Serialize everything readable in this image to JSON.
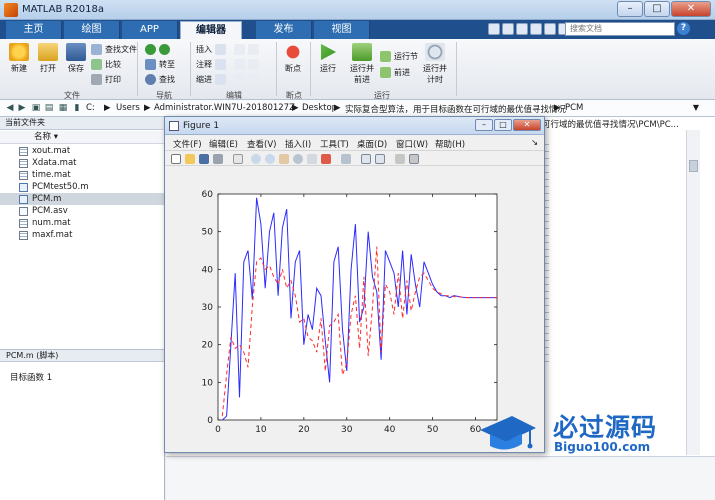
{
  "window": {
    "title": "MATLAB R2018a",
    "minimize": "–",
    "maximize": "□",
    "close": "✕"
  },
  "tabs": [
    {
      "label": "主页"
    },
    {
      "label": "绘图"
    },
    {
      "label": "APP"
    },
    {
      "label": "编辑器"
    },
    {
      "label": "发布"
    },
    {
      "label": "视图"
    }
  ],
  "search": {
    "placeholder": "搜索文档"
  },
  "ribbon": {
    "new": "新建",
    "open": "打开",
    "save": "保存",
    "find_files": "查找文件",
    "compare": "比较",
    "print": "打印",
    "goto": "转至",
    "find": "查找",
    "insert": "插入",
    "comment": "注释",
    "indent": "缩进",
    "breakpoints": "断点",
    "run": "运行",
    "run_advance": [
      "运行并",
      "前进"
    ],
    "run_section": "运行节",
    "advance": "前进",
    "run_time": [
      "运行并",
      "计时"
    ],
    "groups": {
      "file": "文件",
      "nav": "导航",
      "edit": "编辑",
      "breakpoints": "断点",
      "run": "运行"
    }
  },
  "address": {
    "path": [
      "C:",
      "Users",
      "Administrator.WIN7U-20180127Z",
      "Desktop",
      "实际复合型算法，用于目标函数在可行域的最优值寻找情况",
      "PCM"
    ]
  },
  "left_pane": {
    "header": "当前文件夹",
    "column": "名称",
    "files": [
      {
        "name": "xout.mat",
        "kind": "mat"
      },
      {
        "name": "Xdata.mat",
        "kind": "mat"
      },
      {
        "name": "time.mat",
        "kind": "mat"
      },
      {
        "name": "PCMtest50.m",
        "kind": "m"
      },
      {
        "name": "PCM.m",
        "kind": "m",
        "selected": true
      },
      {
        "name": "PCM.asv",
        "kind": "asv"
      },
      {
        "name": "num.mat",
        "kind": "mat"
      },
      {
        "name": "maxf.mat",
        "kind": "mat"
      }
    ],
    "detail_header": "PCM.m  (脚本)",
    "detail_text": "目标函数 1"
  },
  "editor": {
    "crumb": "可行域的最优值寻找情况\\PCM\\PC..."
  },
  "figure": {
    "title": "Figure 1",
    "menu": [
      "文件(F)",
      "编辑(E)",
      "查看(V)",
      "插入(I)",
      "工具(T)",
      "桌面(D)",
      "窗口(W)",
      "帮助(H)"
    ]
  },
  "chart_data": {
    "type": "line",
    "xlim": [
      0,
      65
    ],
    "ylim": [
      0,
      60
    ],
    "xticks": [
      0,
      10,
      20,
      30,
      40,
      50,
      60
    ],
    "yticks": [
      0,
      10,
      20,
      30,
      40,
      50,
      60
    ],
    "grid": false,
    "colors": {
      "series1": "#2b2bff",
      "series2": "#ff2a2a"
    },
    "series": [
      {
        "style": "solid",
        "x": [
          1,
          2,
          3,
          4,
          5,
          6,
          7,
          8,
          9,
          10,
          11,
          12,
          13,
          14,
          15,
          16,
          17,
          18,
          19,
          20,
          21,
          22,
          23,
          24,
          25,
          26,
          27,
          28,
          29,
          30,
          31,
          32,
          33,
          34,
          35,
          36,
          37,
          38,
          39,
          40,
          41,
          42,
          43,
          44,
          45,
          46,
          47,
          48,
          49,
          50,
          51,
          52,
          53,
          54,
          55,
          56,
          57,
          58,
          59,
          60,
          61,
          62,
          63,
          64,
          65
        ],
        "y": [
          0,
          1,
          20,
          39,
          6,
          42,
          45,
          32,
          59,
          52,
          35,
          50,
          55,
          33,
          51,
          56,
          27,
          42,
          45,
          20,
          28,
          24,
          35,
          33,
          21,
          10,
          42,
          46,
          24,
          13,
          40,
          52,
          26,
          30,
          50,
          38,
          34,
          16,
          45,
          42,
          39,
          30,
          45,
          28,
          44,
          36,
          30,
          42,
          39,
          36,
          34,
          33,
          33,
          32.5,
          33,
          32.8,
          32.6,
          32.5,
          32.5,
          32.5,
          32.5,
          32.5,
          32.5,
          32.5,
          32.5
        ]
      },
      {
        "style": "dashed",
        "x": [
          1,
          2,
          3,
          4,
          5,
          6,
          7,
          8,
          9,
          10,
          11,
          12,
          13,
          14,
          15,
          16,
          17,
          18,
          19,
          20,
          21,
          22,
          23,
          24,
          25,
          26,
          27,
          28,
          29,
          30,
          31,
          32,
          33,
          34,
          35,
          36,
          37,
          38,
          39,
          40,
          41,
          42,
          43,
          44,
          45,
          46,
          47,
          48,
          49,
          50,
          51,
          52,
          53,
          54,
          55,
          56,
          57,
          58,
          59,
          60,
          61,
          62,
          63,
          64,
          65
        ],
        "y": [
          1,
          12,
          22,
          19,
          20,
          18,
          14,
          30,
          42,
          43,
          40,
          41,
          38,
          36,
          40,
          35,
          37,
          33,
          26,
          27,
          22,
          21,
          18,
          27,
          13,
          25,
          26,
          28,
          12,
          15,
          28,
          33,
          19,
          38,
          17,
          30,
          46,
          18,
          36,
          34,
          28,
          39,
          27,
          37,
          29,
          34,
          38,
          39,
          37,
          35,
          34,
          33.5,
          33,
          33,
          32.8,
          32.7,
          32.6,
          32.5,
          32.5,
          32.5,
          32.5,
          32.5,
          32.5,
          32.5,
          32.5
        ]
      }
    ]
  },
  "watermark": {
    "cn": "必过源码",
    "en": "Biguo100.com"
  }
}
